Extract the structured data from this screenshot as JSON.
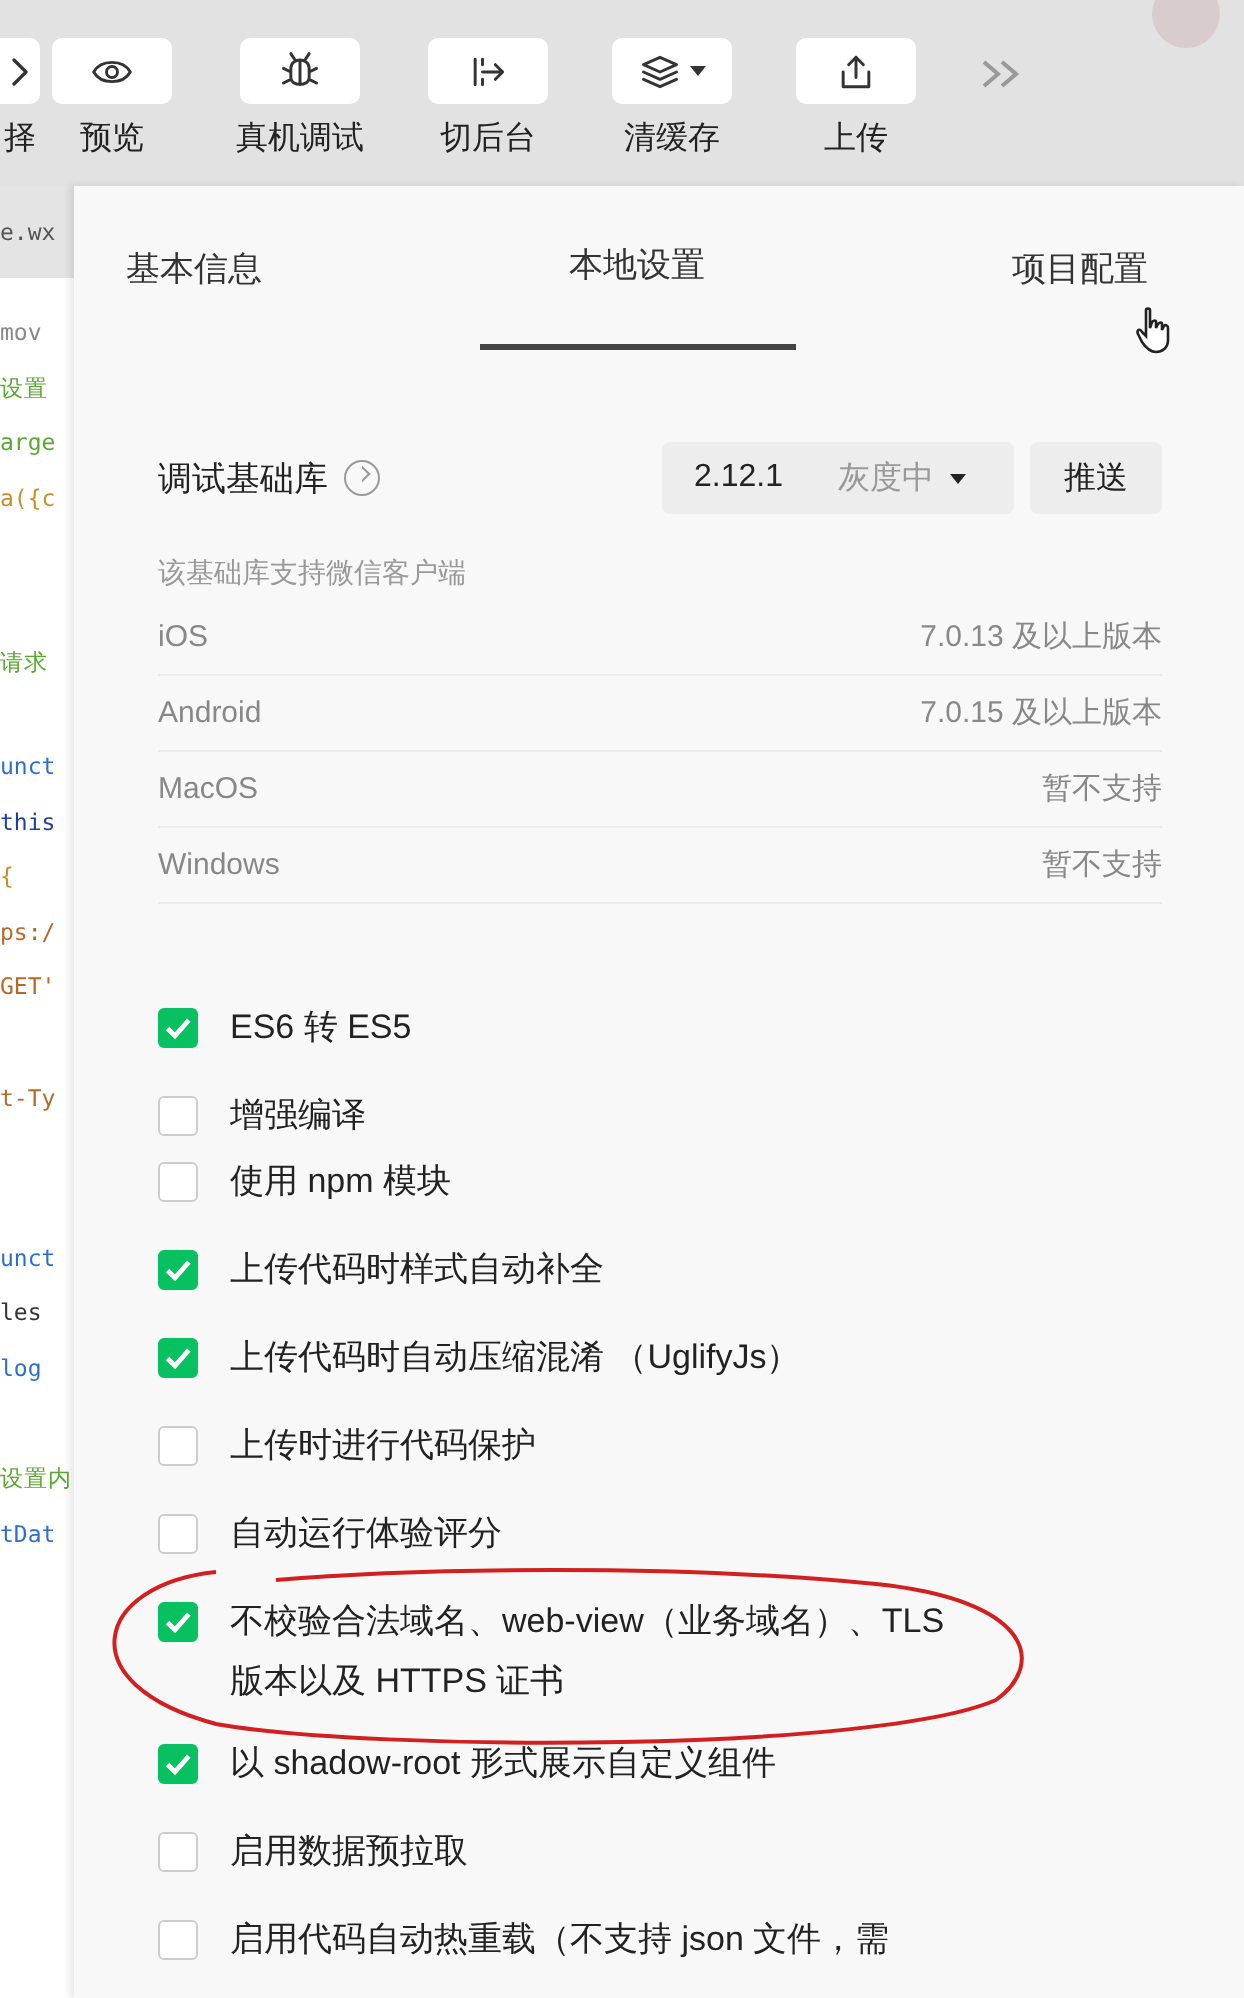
{
  "toolbar": {
    "buttons": [
      {
        "label": "择"
      },
      {
        "label": "预览"
      },
      {
        "label": "真机调试"
      },
      {
        "label": "切后台"
      },
      {
        "label": "清缓存",
        "dropdown": true
      },
      {
        "label": "上传"
      }
    ]
  },
  "editor": {
    "file_tab": "e.wx",
    "lines": [
      {
        "text": "mov",
        "color": "#888888"
      },
      {
        "text": "设置",
        "color": "#5aa832"
      },
      {
        "text": "arge",
        "color": "#5aa832"
      },
      {
        "text": "a({c",
        "color": "#c9902a"
      },
      {
        "text": "请求",
        "color": "#5aa832"
      },
      {
        "text": "unct",
        "color": "#2e6fc4"
      },
      {
        "text": "this",
        "color": "#1f3f9a"
      },
      {
        "text": "{",
        "color": "#c9902a"
      },
      {
        "text": "ps:/",
        "color": "#b36b2a"
      },
      {
        "text": "GET'",
        "color": "#b36b2a"
      },
      {
        "text": "t-Ty",
        "color": "#b36b2a"
      },
      {
        "text": "unct",
        "color": "#2e6fc4"
      },
      {
        "text": "les",
        "color": "#333333"
      },
      {
        "text": "log",
        "color": "#2e6fc4"
      },
      {
        "text": "设置内",
        "color": "#5aa832"
      },
      {
        "text": "tDat",
        "color": "#2e6fc4"
      }
    ]
  },
  "tabs": [
    {
      "label": "基本信息",
      "selected": false
    },
    {
      "label": "本地设置",
      "selected": true
    },
    {
      "label": "项目配置",
      "selected": false
    }
  ],
  "debug_library": {
    "label": "调试基础库",
    "version": "2.12.1",
    "channel": "灰度中",
    "push_button": "推送"
  },
  "support": {
    "title": "该基础库支持微信客户端",
    "rows": [
      {
        "platform": "iOS",
        "requirement": "7.0.13 及以上版本"
      },
      {
        "platform": "Android",
        "requirement": "7.0.15 及以上版本"
      },
      {
        "platform": "MacOS",
        "requirement": "暂不支持"
      },
      {
        "platform": "Windows",
        "requirement": "暂不支持"
      }
    ]
  },
  "options": [
    {
      "label": "ES6 转 ES5",
      "checked": true
    },
    {
      "label": "增强编译",
      "checked": false
    },
    {
      "label": "使用 npm 模块",
      "checked": false
    },
    {
      "label": "上传代码时样式自动补全",
      "checked": true
    },
    {
      "label": "上传代码时自动压缩混淆 （UglifyJs）",
      "checked": true
    },
    {
      "label": "上传时进行代码保护",
      "checked": false
    },
    {
      "label": "自动运行体验评分",
      "checked": false
    },
    {
      "label": "不校验合法域名、web-view（业务域名）、TLS 版本以及 HTTPS 证书",
      "checked": true
    },
    {
      "label": "以 shadow-root 形式展示自定义组件",
      "checked": true
    },
    {
      "label": "启用数据预拉取",
      "checked": false
    },
    {
      "label": "启用代码自动热重载（不支持 json 文件，需",
      "checked": false
    }
  ]
}
